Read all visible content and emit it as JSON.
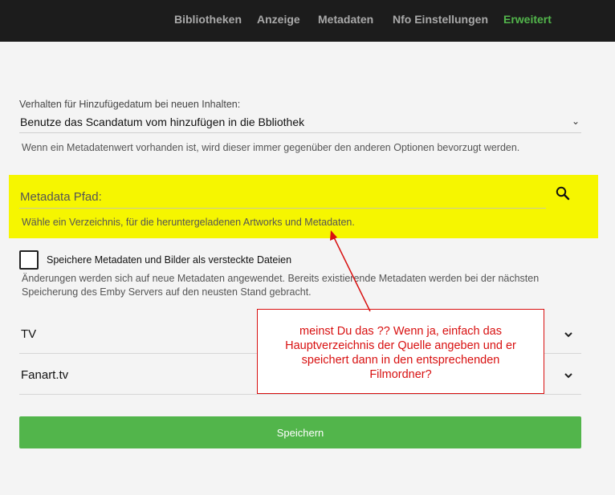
{
  "nav": {
    "tabs": [
      {
        "label": "Bibliotheken",
        "active": false
      },
      {
        "label": "Anzeige",
        "active": false
      },
      {
        "label": "Metadaten",
        "active": false
      },
      {
        "label": "Nfo Einstellungen",
        "active": false
      },
      {
        "label": "Erweitert",
        "active": true
      }
    ]
  },
  "date_added": {
    "label": "Verhalten für Hinzufügedatum bei neuen Inhalten:",
    "value": "Benutze das Scandatum vom hinzufügen in die Bbliothek",
    "help": "Wenn ein Metadatenwert vorhanden ist, wird dieser immer gegenüber den anderen Optionen bevorzugt werden."
  },
  "metadata_path": {
    "placeholder": "Metadata Pfad:",
    "value": "",
    "help": "Wähle ein Verzeichnis, für die heruntergeladenen Artworks und Metadaten."
  },
  "hidden_files": {
    "label": "Speichere Metadaten und Bilder als versteckte Dateien",
    "checked": false,
    "help": "Änderungen werden sich auf neue Metadaten angewendet. Bereits existierende Metadaten werden bei der nächsten Speicherung des Emby Servers auf den neusten Stand gebracht."
  },
  "sections": [
    {
      "title": "TV"
    },
    {
      "title": "Fanart.tv"
    }
  ],
  "save_label": "Speichern",
  "annotation": {
    "text": "meinst Du das ?? Wenn ja, einfach das Hauptverzeichnis der Quelle angeben und er speichert dann in den entsprechenden Filmordner?",
    "color": "#d81010"
  },
  "colors": {
    "accent": "#52b54b",
    "highlight": "#f6f600",
    "topbar": "#1c1c1c"
  }
}
